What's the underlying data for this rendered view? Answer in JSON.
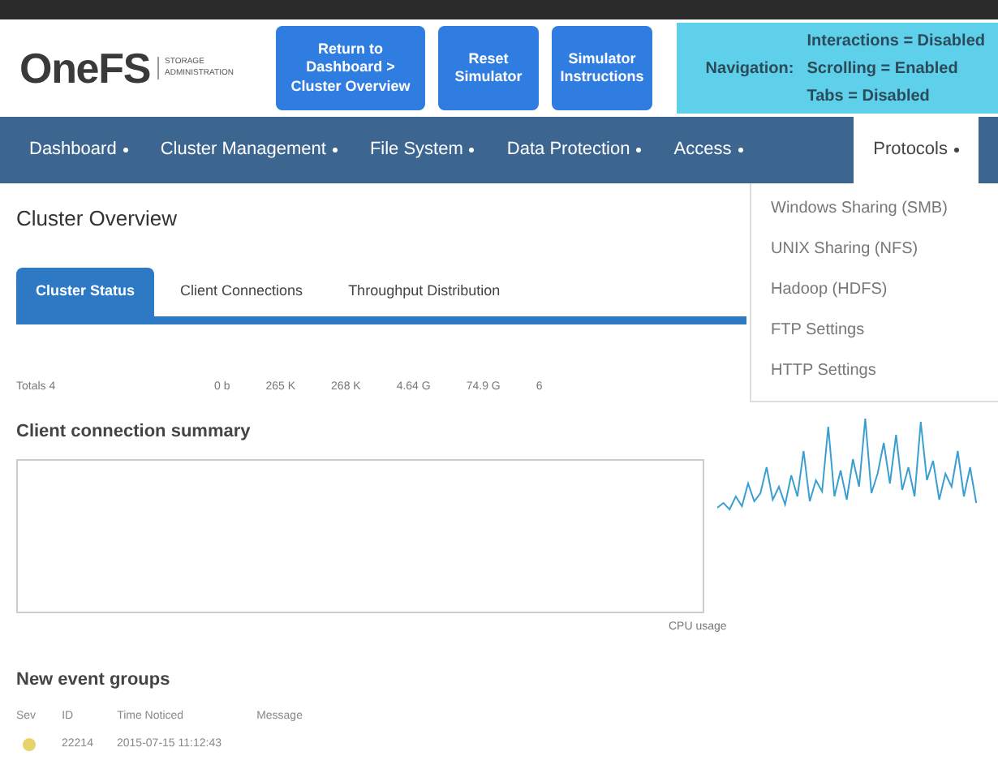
{
  "logo": {
    "name": "OneFS",
    "tagline": "STORAGE ADMINISTRATION"
  },
  "header_buttons": [
    "Return to Dashboard > Cluster Overview",
    "Reset Simulator",
    "Simulator Instructions"
  ],
  "navigation_status": {
    "label": "Navigation:",
    "lines": [
      "Interactions = Disabled",
      "Scrolling = Enabled",
      "Tabs = Disabled"
    ]
  },
  "menu": [
    {
      "label": "Dashboard",
      "selected": false
    },
    {
      "label": "Cluster Management",
      "selected": false
    },
    {
      "label": "File System",
      "selected": false
    },
    {
      "label": "Data Protection",
      "selected": false
    },
    {
      "label": "Access",
      "selected": false
    },
    {
      "label": "Protocols",
      "selected": true
    }
  ],
  "dropdown": [
    "Windows Sharing (SMB)",
    "UNIX Sharing (NFS)",
    "Hadoop (HDFS)",
    "FTP Settings",
    "HTTP Settings"
  ],
  "page_title": "Cluster Overview",
  "tabs": [
    {
      "label": "Cluster Status",
      "selected": true
    },
    {
      "label": "Client Connections",
      "selected": false
    },
    {
      "label": "Throughput Distribution",
      "selected": false
    }
  ],
  "totals": {
    "label": "Totals",
    "values": [
      "4",
      "0 b",
      "265 K",
      "268 K",
      "4.64 G",
      "74.9 G",
      "6"
    ]
  },
  "client_summary": {
    "title": "Client connection summary"
  },
  "cpu": {
    "label": "CPU usage"
  },
  "events": {
    "title": "New event groups",
    "columns": [
      "Sev",
      "ID",
      "Time Noticed",
      "Message"
    ],
    "rows": [
      {
        "id": "22214",
        "time": "2015-07-15 11:12:43"
      }
    ]
  }
}
